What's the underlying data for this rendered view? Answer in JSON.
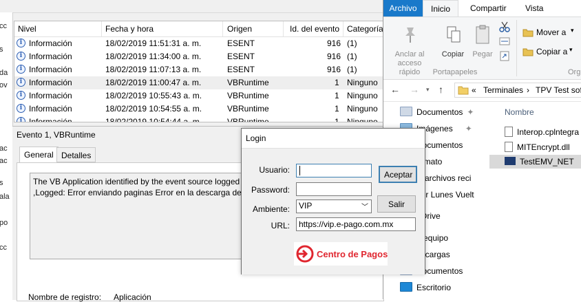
{
  "event_viewer": {
    "left_fragments": [
      "cc",
      "s",
      "da",
      "ov",
      "ac",
      "ac",
      "s",
      "ala",
      "po",
      "cc"
    ],
    "columns": [
      "Nivel",
      "Fecha y hora",
      "Origen",
      "Id. del evento",
      "Categoría"
    ],
    "rows": [
      {
        "level": "Información",
        "date": "18/02/2019 11:51:31 a. m.",
        "source": "ESENT",
        "id": "916",
        "category": "(1)"
      },
      {
        "level": "Información",
        "date": "18/02/2019 11:34:00 a. m.",
        "source": "ESENT",
        "id": "916",
        "category": "(1)"
      },
      {
        "level": "Información",
        "date": "18/02/2019 11:07:13 a. m.",
        "source": "ESENT",
        "id": "916",
        "category": "(1)"
      },
      {
        "level": "Información",
        "date": "18/02/2019 11:00:47 a. m.",
        "source": "VBRuntime",
        "id": "1",
        "category": "Ninguno"
      },
      {
        "level": "Información",
        "date": "18/02/2019 10:55:43 a. m.",
        "source": "VBRuntime",
        "id": "1",
        "category": "Ninguno"
      },
      {
        "level": "Información",
        "date": "18/02/2019 10:54:55 a. m.",
        "source": "VBRuntime",
        "id": "1",
        "category": "Ninguno"
      },
      {
        "level": "Información",
        "date": "18/02/2019 10:54:44 a. m.",
        "source": "VBRuntime",
        "id": "1",
        "category": "Ninguno"
      }
    ],
    "detail": {
      "title": "Evento 1, VBRuntime",
      "tabs": [
        "General",
        "Detalles"
      ],
      "message_line1": "The VB Application identified by the event source logged t",
      "message_line2": ",Logged: Error enviando paginas Error en la descarga del re",
      "log_name_label": "Nombre de registro:",
      "log_name_value": "Aplicación"
    }
  },
  "explorer": {
    "tabs": [
      "Archivo",
      "Inicio",
      "Compartir",
      "Vista"
    ],
    "ribbon": {
      "pin_label_1": "Anclar al",
      "pin_label_2": "acceso rápido",
      "copy_label": "Copiar",
      "paste_label": "Pegar",
      "move_label": "Mover a",
      "copyto_label": "Copiar a",
      "group_clipboard": "Portapapeles",
      "group_org": "Org"
    },
    "address": {
      "prefix": "«",
      "segments": [
        "Terminales",
        "TPV Test sof"
      ]
    },
    "tree": [
      "Documentos",
      "Imágenes",
      "Documentos",
      "ormato",
      "is archivos reci",
      "ber Lunes Vuelt",
      "eDrive",
      "e equipo",
      "escargas",
      "Documentos",
      "Escritorio"
    ],
    "column_header": "Nombre",
    "files": [
      "Interop.cplntegra",
      "MITEncrypt.dll",
      "TestEMV_NET"
    ]
  },
  "login": {
    "title": "Login",
    "usuario_label": "Usuario:",
    "usuario_value": "",
    "password_label": "Password:",
    "password_value": "",
    "ambiente_label": "Ambiente:",
    "ambiente_value": "VIP",
    "url_label": "URL:",
    "url_value": "https://vip.e-pago.com.mx",
    "accept_label": "Aceptar",
    "exit_label": "Salir",
    "brand": "Centro de Pagos",
    "brand_color": "#e0262f"
  }
}
